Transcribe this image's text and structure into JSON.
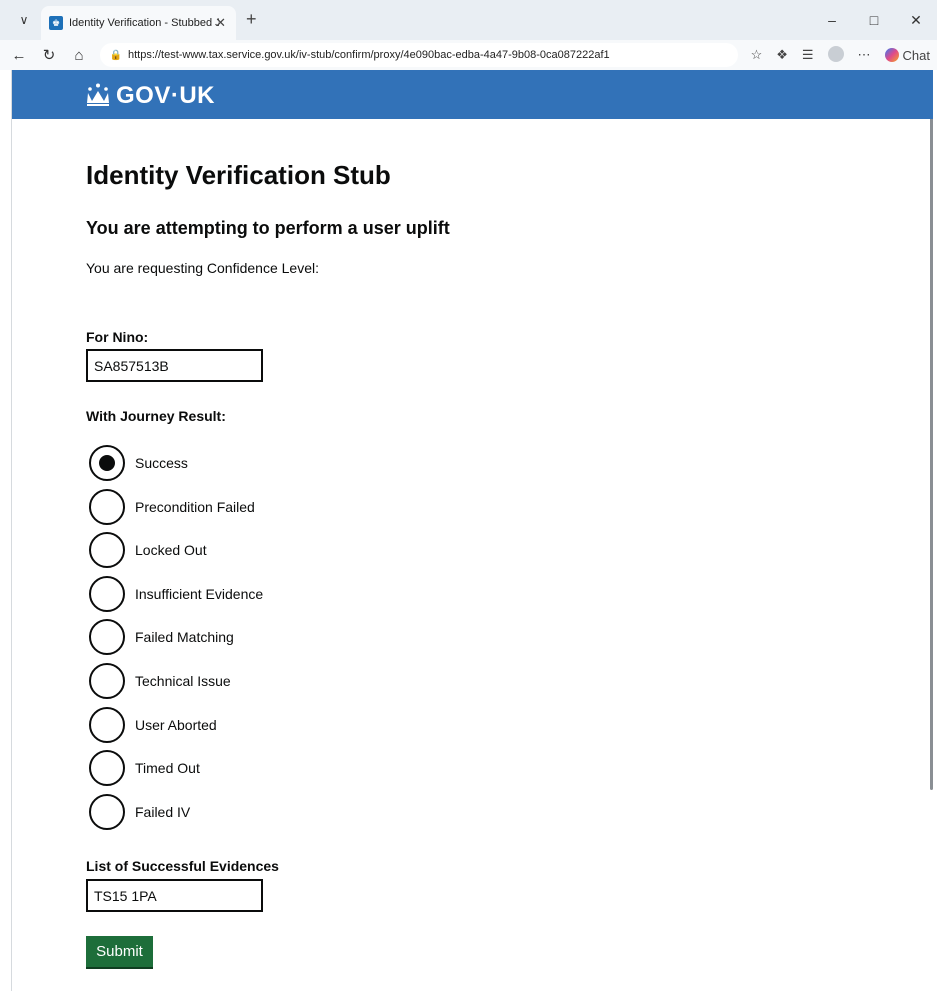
{
  "browser": {
    "tab_title": "Identity Verification - Stubbed Jou",
    "url": "https://test-www.tax.service.gov.uk/iv-stub/confirm/proxy/4e090bac-edba-4a47-9b08-0ca087222af1",
    "chat_label": "Chat"
  },
  "header": {
    "logo_text": "GOV·UK"
  },
  "page": {
    "title": "Identity Verification Stub",
    "subtitle": "You are attempting to perform a user uplift",
    "lead": "You are requesting Confidence Level:"
  },
  "form": {
    "nino_label": "For Nino:",
    "nino_value": "SA857513B",
    "journey_label": "With Journey Result:",
    "options": [
      {
        "label": "Success",
        "checked": true
      },
      {
        "label": "Precondition Failed",
        "checked": false
      },
      {
        "label": "Locked Out",
        "checked": false
      },
      {
        "label": "Insufficient Evidence",
        "checked": false
      },
      {
        "label": "Failed Matching",
        "checked": false
      },
      {
        "label": "Technical Issue",
        "checked": false
      },
      {
        "label": "User Aborted",
        "checked": false
      },
      {
        "label": "Timed Out",
        "checked": false
      },
      {
        "label": "Failed IV",
        "checked": false
      }
    ],
    "evidence_label": "List of Successful Evidences",
    "evidence_value": "TS15 1PA",
    "submit_label": "Submit"
  },
  "colors": {
    "header_blue": "#3272b8",
    "submit_green": "#1d6e3a",
    "text": "#0b0c0c"
  }
}
